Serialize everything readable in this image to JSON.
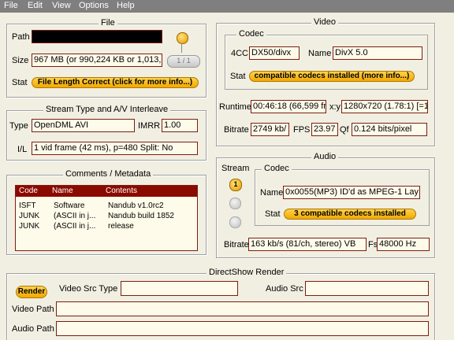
{
  "menu": {
    "file": "File",
    "edit": "Edit",
    "view": "View",
    "options": "Options",
    "help": "Help"
  },
  "file": {
    "title": "File",
    "path_label": "Path",
    "path_value": "",
    "size_label": "Size",
    "size_value": "967 MB (or 990,224 KB or 1,013,",
    "counter": "1 / 1",
    "stat_label": "Stat",
    "stat_value": "File Length Correct (click for more info...)"
  },
  "stream": {
    "title": "Stream Type and A/V Interleave",
    "type_label": "Type",
    "type_value": "OpenDML AVI",
    "imrr_label": "IMRR",
    "imrr_value": "1.00",
    "il_label": "I/L",
    "il_value": "1 vid frame (42 ms), p=480  Split: No"
  },
  "comments": {
    "title": "Comments / Metadata",
    "headers": [
      "Code",
      "Name",
      "Contents"
    ],
    "rows": [
      {
        "code": "ISFT",
        "name": "Software",
        "contents": "Nandub v1.0rc2"
      },
      {
        "code": "JUNK",
        "name": "(ASCII in j...",
        "contents": "Nandub build 1852"
      },
      {
        "code": "JUNK",
        "name": "(ASCII in j...",
        "contents": "release"
      }
    ]
  },
  "video": {
    "title": "Video",
    "codec_title": "Codec",
    "fourcc_label": "4CC",
    "fourcc_value": "DX50/divx",
    "name_label": "Name",
    "name_value": "DivX 5.0",
    "stat_label": "Stat",
    "stat_value": "compatible codecs installed (more info...)",
    "runtime_label": "Runtime",
    "runtime_value": "00:46:18 (66,599 fr",
    "xy_label": "x:y",
    "xy_value": "1280x720 (1.78:1) [=1",
    "bitrate_label": "Bitrate",
    "bitrate_value": "2749 kb/",
    "fps_label": "FPS",
    "fps_value": "23.97",
    "qf_label": "Qf",
    "qf_value": "0.124 bits/pixel"
  },
  "audio": {
    "title": "Audio",
    "stream_label": "Stream",
    "stream_num": "1",
    "codec_title": "Codec",
    "name_label": "Name",
    "name_value": "0x0055(MP3) ID'd as MPEG-1 Lay",
    "stat_label": "Stat",
    "stat_value": "3 compatible codecs installed",
    "bitrate_label": "Bitrate",
    "bitrate_value": "163 kb/s (81/ch, stereo) VB",
    "fs_label": "Fs",
    "fs_value": "48000 Hz"
  },
  "directshow": {
    "title": "DirectShow Render",
    "render_label": "Render",
    "video_src_label": "Video Src Type",
    "video_src_value": "",
    "audio_src_label": "Audio Src",
    "audio_src_value": "",
    "video_path_label": "Video Path",
    "video_path_value": "",
    "audio_path_label": "Audio Path",
    "audio_path_value": ""
  },
  "colors": {
    "accent": "#8a0a00",
    "field_bg": "#fffbea",
    "pill": "#f2a800",
    "window_bg": "#f1efe2"
  }
}
